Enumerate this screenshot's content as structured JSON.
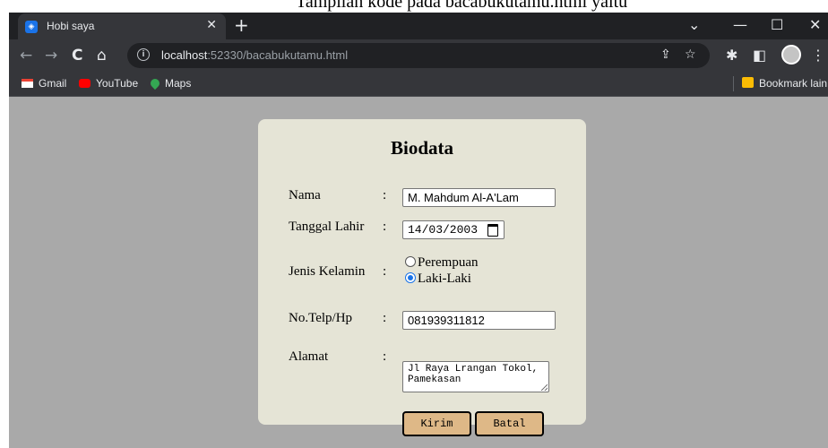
{
  "cutoff_text": "Tampilan kode pada bacabukutamu.html yaitu",
  "tab": {
    "title": "Hobi saya",
    "close": "✕",
    "new_tab": "+"
  },
  "window_controls": {
    "dropdown": "⌄",
    "minimize": "—",
    "maximize": "☐",
    "close": "✕"
  },
  "nav": {
    "back": "←",
    "forward": "→",
    "reload": "C",
    "home": "⌂"
  },
  "address": {
    "host": "localhost",
    "path": ":52330/bacabukutamu.html",
    "info_icon": "i"
  },
  "toolbar_icons": {
    "share": "⇪",
    "star": "☆",
    "extensions": "✱",
    "sidepanel": "◧",
    "menu": "⋮"
  },
  "bookmarks": [
    {
      "label": "Gmail",
      "icon": "gmail-icon"
    },
    {
      "label": "YouTube",
      "icon": "youtube-icon"
    },
    {
      "label": "Maps",
      "icon": "maps-icon"
    }
  ],
  "bookmark_other": "Bookmark lain",
  "form": {
    "title": "Biodata",
    "colon": ":",
    "nama_label": "Nama",
    "nama_value": "M. Mahdum Al-A'Lam",
    "tgl_label": "Tanggal Lahir",
    "tgl_value": "14/03/2003",
    "jk_label": "Jenis Kelamin",
    "jk_option1": "Perempuan",
    "jk_option2": "Laki-Laki",
    "jk_selected": "Laki-Laki",
    "telp_label": "No.Telp/Hp",
    "telp_value": "081939311812",
    "alamat_label": "Alamat",
    "alamat_line1": "Jl Raya Lrangan Tokol,",
    "alamat_line2": "Pamekasan",
    "submit_label": "Kirim",
    "cancel_label": "Batal"
  },
  "colors": {
    "page_bg": "#a9a9a9",
    "card_bg": "#e5e4d6",
    "button_bg": "#deb887",
    "radio_accent": "#1a73e8"
  }
}
